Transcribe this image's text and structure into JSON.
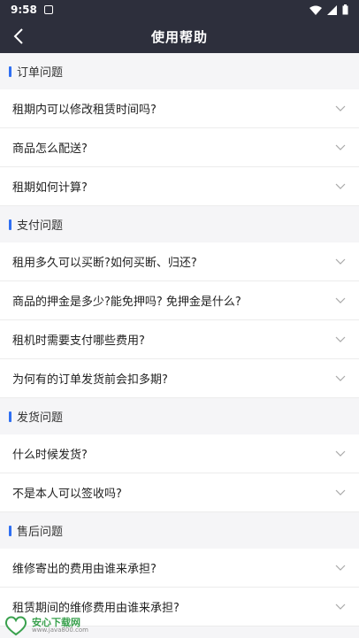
{
  "status_bar": {
    "time": "9:58"
  },
  "nav": {
    "title": "使用帮助"
  },
  "sections": [
    {
      "title": "订单问题",
      "items": [
        "租期内可以修改租赁时间吗?",
        "商品怎么配送?",
        "租期如何计算?"
      ]
    },
    {
      "title": "支付问题",
      "items": [
        "租用多久可以买断?如何买断、归还?",
        "商品的押金是多少?能免押吗? 免押金是什么?",
        "租机时需要支付哪些费用?",
        "为何有的订单发货前会扣多期?"
      ]
    },
    {
      "title": "发货问题",
      "items": [
        "什么时候发货?",
        "不是本人可以签收吗?"
      ]
    },
    {
      "title": "售后问题",
      "items": [
        "维修寄出的费用由谁来承担?",
        "租赁期间的维修费用由谁来承担?"
      ]
    }
  ],
  "watermark": {
    "title": "安心下载网",
    "url": "www.java800.com",
    "logo_text": "安心下载"
  },
  "colors": {
    "header_bg": "#2d2f3c",
    "accent": "#2f6ff2"
  }
}
